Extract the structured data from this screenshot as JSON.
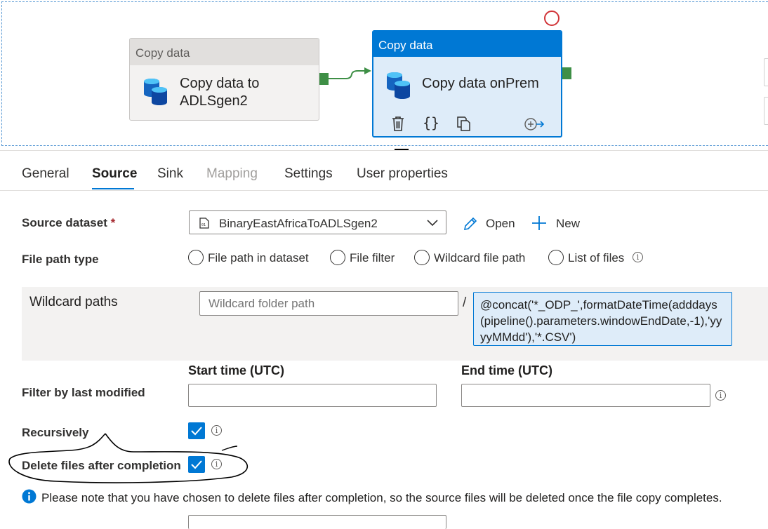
{
  "canvas": {
    "activity1": {
      "type_label": "Copy data",
      "name_line1": "Copy data to",
      "name_line2": "ADLSgen2"
    },
    "activity2": {
      "type_label": "Copy data",
      "name": "Copy data onPrem"
    }
  },
  "tabs": [
    {
      "label": "General"
    },
    {
      "label": "Source",
      "active": true
    },
    {
      "label": "Sink"
    },
    {
      "label": "Mapping",
      "disabled": true
    },
    {
      "label": "Settings"
    },
    {
      "label": "User properties"
    }
  ],
  "source": {
    "dataset_label": "Source dataset",
    "required_mark": "*",
    "dataset_value": "BinaryEastAfricaToADLSgen2",
    "open_label": "Open",
    "new_label": "New",
    "file_path_type_label": "File path type",
    "file_path_options": [
      "File path in dataset",
      "File filter",
      "Wildcard file path",
      "List of files"
    ],
    "wildcard_label": "Wildcard paths",
    "wildcard_folder_placeholder": "Wildcard folder path",
    "path_separator": "/",
    "wildcard_file_value": "@concat('*_ODP_',formatDateTime(adddays(pipeline().parameters.windowEndDate,-1),'yyyyMMdd'),'*.CSV')",
    "filter_label": "Filter by last modified",
    "start_time_label": "Start time (UTC)",
    "end_time_label": "End time (UTC)",
    "recursively_label": "Recursively",
    "recursively_checked": true,
    "delete_label": "Delete files after completion",
    "delete_checked": true,
    "delete_notice": "Please note that you have chosen to delete files after completion, so the source files will be deleted once the file copy completes."
  },
  "colors": {
    "accent": "#0078d4",
    "port": "#3e8f46",
    "error": "#d13438"
  }
}
